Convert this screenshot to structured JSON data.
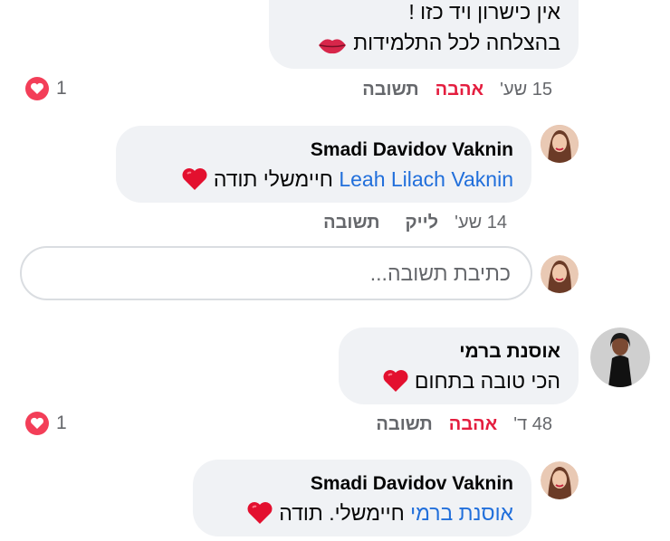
{
  "comments": [
    {
      "line1": "אין כישרון ויד כזו !",
      "line2": "בהצלחה לכל התלמידות",
      "line2_emoji": "lips-icon",
      "time": "15 שע'",
      "love_label": "אהבה",
      "reply_label": "תשובה",
      "reaction_count": "1"
    },
    {
      "author": "Smadi Davidov Vaknin",
      "mention": "Leah Lilach Vaknin",
      "text": " חיימשלי תודה ",
      "emoji": "red-heart-icon",
      "time": "14 שע'",
      "like_label": "לייק",
      "reply_label": "תשובה"
    },
    {
      "author": "אוסנת ברמי",
      "text": "הכי טובה בתחום ",
      "emoji": "red-heart-icon",
      "time": "48 ד'",
      "love_label": "אהבה",
      "reply_label": "תשובה",
      "reaction_count": "1"
    },
    {
      "author": "Smadi Davidov Vaknin",
      "mention": "אוסנת ברמי",
      "text": " חיימשלי. תודה ",
      "emoji": "red-heart-icon"
    }
  ],
  "reply_box": {
    "placeholder": "כתיבת תשובה..."
  },
  "colors": {
    "bubble": "#f0f2f5",
    "mention": "#216fdb",
    "love": "#e41e3f",
    "meta": "#65676b"
  }
}
